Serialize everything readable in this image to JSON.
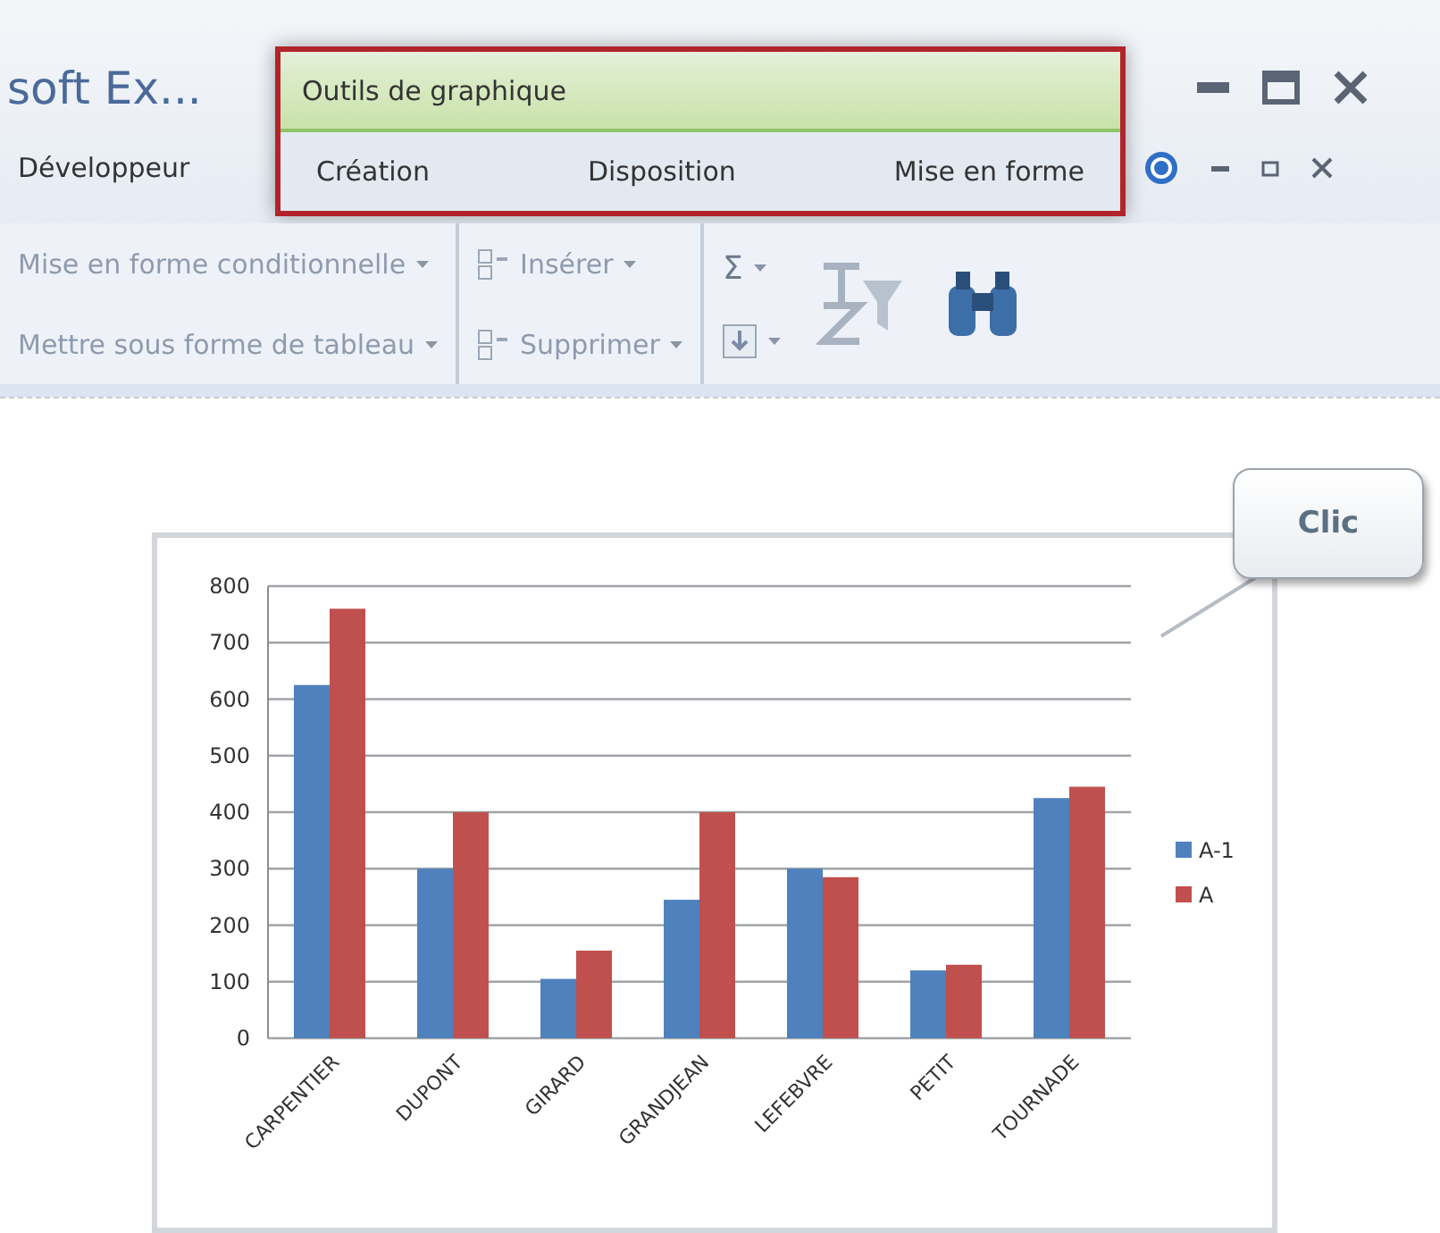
{
  "window": {
    "title": "soft Ex..."
  },
  "tabs": [
    {
      "label": "Développeur",
      "selected": false
    }
  ],
  "contextual_tabs": {
    "title": "Outils de graphique",
    "tabs": [
      {
        "label": "Création",
        "selected": false
      },
      {
        "label": "Disposition",
        "selected": false
      },
      {
        "label": "Mise en forme",
        "selected": false
      }
    ]
  },
  "ribbon": {
    "styles": [
      "Mise en forme conditionnelle",
      "Mettre sous forme de tableau"
    ],
    "cells": [
      "Insérer",
      "Supprimer"
    ],
    "sum_symbol": "Σ"
  },
  "callout": {
    "text": "Clic"
  },
  "chart": {
    "chart_data": {
      "type": "bar",
      "categories": [
        "CARPENTIER",
        "DUPONT",
        "GIRARD",
        "GRANDJEAN",
        "LEFEBVRE",
        "PETIT",
        "TOURNADE"
      ],
      "series": [
        {
          "name": "A-1",
          "color": "#4f81bd",
          "values": [
            625,
            300,
            105,
            245,
            300,
            120,
            425
          ]
        },
        {
          "name": "A",
          "color": "#c0504d",
          "values": [
            760,
            400,
            155,
            400,
            285,
            130,
            445
          ]
        }
      ],
      "grid": true,
      "legend": true,
      "ylim": [
        0,
        800
      ],
      "yticks": [
        0,
        100,
        200,
        300,
        400,
        500,
        600,
        700,
        800
      ]
    }
  }
}
